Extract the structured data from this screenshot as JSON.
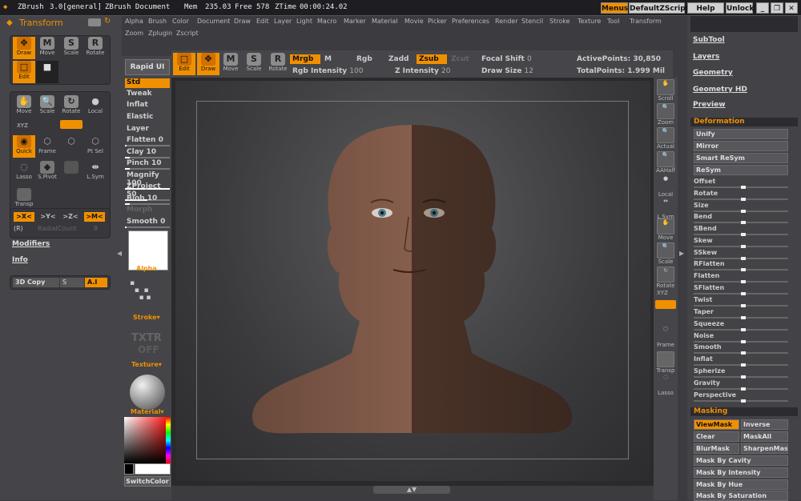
{
  "titlebar": {
    "app": "ZBrush",
    "version": "3.0[general]",
    "doc": "ZBrush Document",
    "mem_label": "Mem",
    "mem": "235.03",
    "free_label": "Free",
    "free": "578",
    "ztime_label": "ZTime",
    "ztime": "00:00:24.02",
    "menus": "Menus",
    "default_zscript": "DefaultZScript",
    "help": "Help",
    "unlock": "Unlock"
  },
  "menubar": {
    "row1": [
      "Alpha",
      "Brush",
      "Color",
      "Document",
      "Draw",
      "Edit",
      "Layer",
      "Light",
      "Macro",
      "Marker",
      "Material",
      "Movie",
      "Picker",
      "Preferences",
      "Render",
      "Stencil",
      "Stroke",
      "Texture",
      "Tool",
      "Transform"
    ],
    "row2": [
      "Zoom",
      "Zplugin",
      "Zscript"
    ]
  },
  "left": {
    "palette_title": "Transform",
    "row1": [
      {
        "label": "Draw",
        "glyph": "✥"
      },
      {
        "label": "Move",
        "glyph": "M"
      },
      {
        "label": "Scale",
        "glyph": "S"
      },
      {
        "label": "Rotate",
        "glyph": "R"
      }
    ],
    "row2": [
      {
        "label": "Edit",
        "glyph": "□"
      }
    ],
    "row3": [
      {
        "label": "Move",
        "glyph": "✋"
      },
      {
        "label": "Scale",
        "glyph": "🔍"
      },
      {
        "label": "Rotate",
        "glyph": "↻"
      },
      {
        "label": "Local",
        "glyph": "●"
      }
    ],
    "xyz": "XYZ",
    "row4": [
      {
        "label": "Quick",
        "glyph": "◉"
      },
      {
        "label": "Frame",
        "glyph": "⬡"
      },
      {
        "label": "",
        "glyph": "⬡"
      },
      {
        "label": "Pt Sel",
        "glyph": "⬡"
      }
    ],
    "row5": [
      {
        "label": "Lasso",
        "glyph": "◌"
      },
      {
        "label": "S.Pivot",
        "glyph": "◆"
      },
      {
        "label": "",
        "glyph": ""
      },
      {
        "label": "L.Sym",
        "glyph": "⇹"
      }
    ],
    "transp": "Transp",
    "sym_buttons": [
      ">X<",
      ">Y<",
      ">Z<",
      ">M<"
    ],
    "sym_r": "(R)",
    "radial_label": "RadialCount",
    "radial_value": "8",
    "modifiers": "Modifiers",
    "info": "Info",
    "copy3d": "3D Copy",
    "s_label": "S",
    "ai_label": "A.I"
  },
  "brush": {
    "rapid": "Rapid UI",
    "items": [
      {
        "name": "Std",
        "value": ""
      },
      {
        "name": "Tweak",
        "value": ""
      },
      {
        "name": "Inflat",
        "value": ""
      },
      {
        "name": "Elastic",
        "value": ""
      },
      {
        "name": "Layer",
        "value": ""
      },
      {
        "name": "Flatten",
        "value": "0"
      },
      {
        "name": "Clay",
        "value": "10"
      },
      {
        "name": "Pinch",
        "value": "10"
      },
      {
        "name": "Magnify",
        "value": "100"
      },
      {
        "name": "ZProject",
        "value": "50"
      },
      {
        "name": "Blob",
        "value": "10"
      },
      {
        "name": "Morph",
        "value": ""
      },
      {
        "name": "Smooth",
        "value": "0"
      }
    ],
    "alpha": "Alpha",
    "stroke": "Stroke",
    "txtr": "TXTR",
    "off": "OFF",
    "texture": "Texture",
    "material": "Material",
    "switchcolor": "SwitchColor"
  },
  "toolbar": {
    "buttons": [
      {
        "label": "Edit",
        "glyph": "□"
      },
      {
        "label": "Draw",
        "glyph": "✥"
      },
      {
        "label": "Move",
        "glyph": "M"
      },
      {
        "label": "Scale",
        "glyph": "S"
      },
      {
        "label": "Rotate",
        "glyph": "R"
      }
    ],
    "mrgb": "Mrgb",
    "m": "M",
    "rgb": "Rgb",
    "zadd": "Zadd",
    "zsub": "Zsub",
    "zcut": "Zcut",
    "rgb_intensity_label": "Rgb Intensity",
    "rgb_intensity": "100",
    "z_intensity_label": "Z Intensity",
    "z_intensity": "20",
    "focal_label": "Focal Shift",
    "focal": "0",
    "draw_size_label": "Draw Size",
    "draw_size": "12",
    "active_label": "ActivePoints:",
    "active": "30,850",
    "total_label": "TotalPoints:",
    "total": "1.999 Mil"
  },
  "shelf": [
    {
      "label": "Scroll",
      "glyph": "✋"
    },
    {
      "label": "Zoom",
      "glyph": "🔍"
    },
    {
      "label": "Actual",
      "glyph": "🔍"
    },
    {
      "label": "AAHalf",
      "glyph": "🔍"
    },
    {
      "label": "Local",
      "glyph": "●"
    },
    {
      "label": "L.Sym",
      "glyph": "⇹"
    },
    {
      "label": "Move",
      "glyph": "✋"
    },
    {
      "label": "Scale",
      "glyph": "🔍"
    },
    {
      "label": "Rotate",
      "glyph": "↻"
    },
    {
      "label": "XYZ",
      "glyph": ""
    },
    {
      "label": "",
      "glyph": ""
    },
    {
      "label": "Frame",
      "glyph": "⬡"
    },
    {
      "label": "Transp",
      "glyph": ""
    },
    {
      "label": "Lasso",
      "glyph": "◌"
    }
  ],
  "right": {
    "links": [
      "SubTool",
      "Layers",
      "Geometry",
      "Geometry HD",
      "Preview"
    ],
    "deformation": "Deformation",
    "def_buttons": [
      "Unify",
      "Mirror",
      "Smart ReSym",
      "ReSym"
    ],
    "def_sliders": [
      "Offset",
      "Rotate",
      "Size",
      "Bend",
      "SBend",
      "Skew",
      "SSkew",
      "RFlatten",
      "Flatten",
      "SFlatten",
      "Twist",
      "Taper",
      "Squeeze",
      "Noise",
      "Smooth",
      "Inflat",
      "Spherize",
      "Gravity",
      "Perspective"
    ],
    "masking": "Masking",
    "mask_buttons": [
      [
        "ViewMask",
        "Inverse"
      ],
      [
        "Clear",
        "MaskAll"
      ],
      [
        "BlurMask",
        "SharpenMask"
      ]
    ],
    "mask_wide": [
      "Mask By Cavity",
      "Mask By Intensity",
      "Mask By Hue",
      "Mask By Saturation"
    ]
  },
  "colors": {
    "accent": "#f09000",
    "panel": "#454549",
    "dark": "#2c2c30"
  }
}
